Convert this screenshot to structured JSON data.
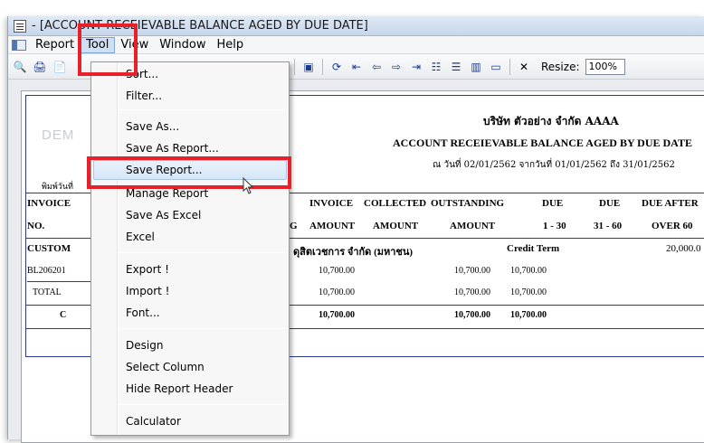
{
  "window": {
    "title": "- [ACCOUNT RECEIEVABLE BALANCE AGED BY DUE DATE]"
  },
  "menubar": {
    "items": [
      {
        "label": "Report"
      },
      {
        "label": "Tool"
      },
      {
        "label": "View"
      },
      {
        "label": "Window"
      },
      {
        "label": "Help"
      }
    ]
  },
  "toolbar": {
    "buttons": [
      "print-preview-icon",
      "print-icon",
      "export-icon",
      "grid-icon",
      "column-icon",
      "calculator-icon",
      "refresh-icon",
      "first-page-icon",
      "prev-page-icon",
      "next-page-icon",
      "last-page-icon",
      "list-icon",
      "rows-icon",
      "columns-icon",
      "window-icon",
      "close-icon"
    ],
    "resize_label": "Resize:",
    "resize_value": "100%"
  },
  "report": {
    "watermark": "DEM",
    "company": "บริษัท ตัวอย่าง จำกัด   AAAA",
    "title": "ACCOUNT RECEIEVABLE BALANCE AGED BY DUE DATE",
    "subtitle": "ณ วันที่ 02/01/2562 จากวันที่ 01/01/2562 ถึง 31/01/2562",
    "printed": "พิมพ์วันที่",
    "header1": {
      "c1": "INVOICE",
      "c2": "INVOICE",
      "c3": "COLLECTED",
      "c4": "OUTSTANDING",
      "c5": "DUE",
      "c6": "DUE",
      "c7": "DUE AFTER"
    },
    "header2": {
      "c1": "NO.",
      "c2": "G",
      "c3": "AMOUNT",
      "c4": "AMOUNT",
      "c5": "AMOUNT",
      "c6": "1 - 30",
      "c7": "31 - 60",
      "c8": "OVER 60"
    },
    "customer_row": {
      "label": "CUSTOM",
      "name": "ดุสิตเวชการ จำกัด (มหาชน)",
      "term": "Credit Term",
      "limit": "20,000.0"
    },
    "detail_row": {
      "invoice": "BL206201",
      "amount": "10,700.00",
      "outstanding": "10,700.00",
      "due1": "10,700.00"
    },
    "total_row": {
      "label": "TOTAL",
      "amount": "10,700.00",
      "outstanding": "10,700.00",
      "due1": "10,700.00"
    },
    "grand_row": {
      "label": "C",
      "amount": "10,700.00",
      "outstanding": "10,700.00",
      "due1": "10,700.00"
    }
  },
  "dropdown": {
    "items": [
      {
        "label": "Sort...",
        "name": "menu-sort"
      },
      {
        "label": "Filter...",
        "name": "menu-filter"
      },
      {
        "label": "Save As...",
        "name": "menu-save-as"
      },
      {
        "label": "Save As Report...",
        "name": "menu-save-as-report"
      },
      {
        "label": "Save Report...",
        "name": "menu-save-report"
      },
      {
        "label": "Manage Report",
        "name": "menu-manage-report"
      },
      {
        "label": "Save As Excel",
        "name": "menu-save-as-excel"
      },
      {
        "label": "Excel",
        "name": "menu-excel"
      },
      {
        "label": "Export !",
        "name": "menu-export"
      },
      {
        "label": "Import !",
        "name": "menu-import"
      },
      {
        "label": "Font...",
        "name": "menu-font"
      },
      {
        "label": "Design",
        "name": "menu-design"
      },
      {
        "label": "Select Column",
        "name": "menu-select-column"
      },
      {
        "label": "Hide Report Header",
        "name": "menu-hide-report-header"
      },
      {
        "label": "Calculator",
        "name": "menu-calculator"
      }
    ]
  },
  "colors": {
    "highlight": "#e8202a",
    "report_border": "#2b3a8f"
  }
}
